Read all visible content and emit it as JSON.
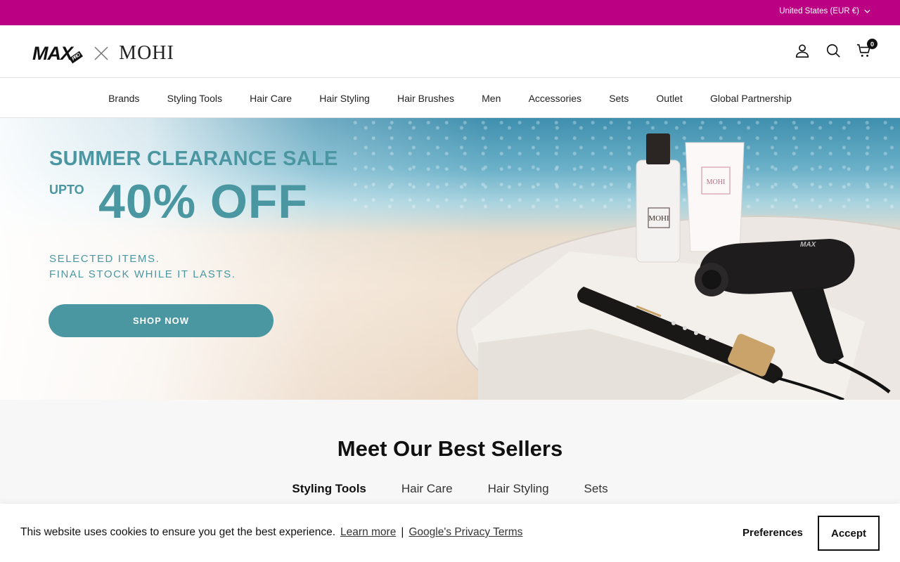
{
  "topbar": {
    "country_label": "United States (EUR €)"
  },
  "logo": {
    "max": "MAX",
    "pro": "PRO",
    "mohi": "MOHI"
  },
  "header": {
    "cart_count": "0"
  },
  "nav": {
    "items": [
      "Brands",
      "Styling Tools",
      "Hair Care",
      "Hair Styling",
      "Hair Brushes",
      "Men",
      "Accessories",
      "Sets",
      "Outlet",
      "Global Partnership"
    ]
  },
  "hero": {
    "title": "SUMMER CLEARANCE SALE",
    "upto": "UPTO",
    "discount": "40% OFF",
    "sub1": "SELECTED ITEMS.",
    "sub2": "FINAL STOCK WHILE IT LASTS.",
    "cta": "SHOP NOW",
    "bottle_label": "MOHI",
    "tube_label": "MOHI",
    "dryer_label": "MAX"
  },
  "sellers": {
    "heading": "Meet Our Best Sellers",
    "tabs": [
      "Styling Tools",
      "Hair Care",
      "Hair Styling",
      "Sets"
    ],
    "active_tab": "Styling Tools"
  },
  "cookie": {
    "message": "This website uses cookies to ensure you get the best experience.",
    "learn_more": "Learn more",
    "separator": "|",
    "privacy": "Google's Privacy Terms",
    "preferences": "Preferences",
    "accept": "Accept"
  },
  "colors": {
    "brand_magenta": "#bc0083",
    "teal": "#4a96a1"
  }
}
